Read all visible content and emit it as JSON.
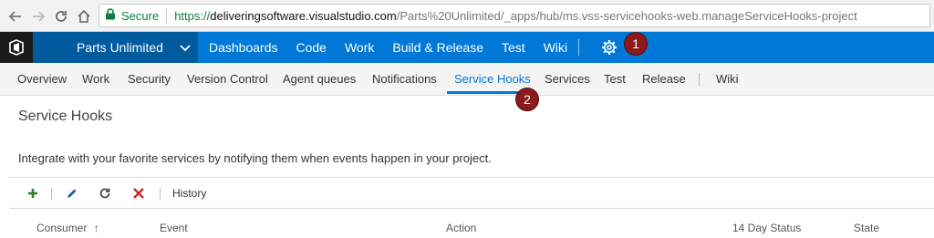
{
  "browser": {
    "secure_label": "Secure",
    "url_scheme": "https://",
    "url_host": "deliveringsoftware.visualstudio.com",
    "url_path": "/Parts%20Unlimited/_apps/hub/ms.vss-servicehooks-web.manageServiceHooks-project"
  },
  "topbar": {
    "project": "Parts Unlimited",
    "nav": [
      "Dashboards",
      "Code",
      "Work",
      "Build & Release",
      "Test",
      "Wiki"
    ]
  },
  "markers": [
    "1",
    "2"
  ],
  "subnav": {
    "tabs": [
      "Overview",
      "Work",
      "Security",
      "Version Control",
      "Agent queues",
      "Notifications",
      "Service Hooks",
      "Services",
      "Test",
      "Release",
      "Wiki"
    ]
  },
  "page": {
    "title": "Service Hooks",
    "description": "Integrate with your favorite services by notifying them when events happen in your project."
  },
  "toolbar": {
    "history_label": "History"
  },
  "table": {
    "columns": [
      "Consumer",
      "Event",
      "Action",
      "14 Day Status",
      "State"
    ],
    "sort_indicator": "↑"
  },
  "colors": {
    "accent": "#0078d7",
    "project_bg": "#005a9e",
    "marker": "#8b1a1a"
  }
}
